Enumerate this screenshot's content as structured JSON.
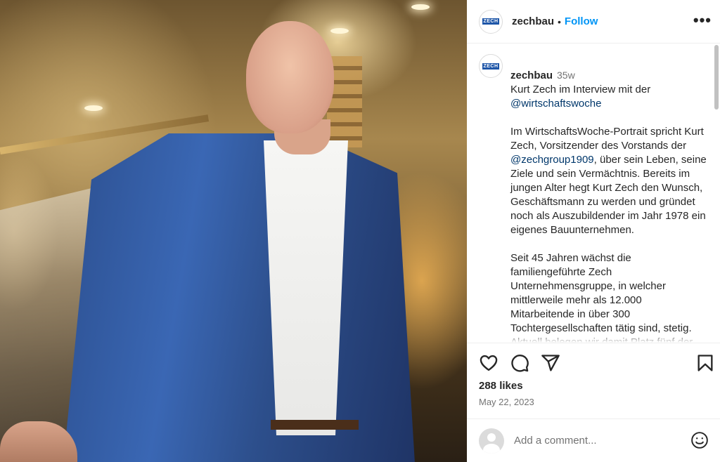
{
  "post": {
    "image_alt": "Kurt Zech in a blue suit standing on a staircase"
  },
  "header": {
    "avatar_logo": "ZECH",
    "username": "zechbau",
    "separator": "•",
    "follow_label": "Follow",
    "more_label": "•••"
  },
  "caption": {
    "username": "zechbau",
    "time": "35w",
    "line1": "Kurt Zech im Interview mit der",
    "mention1": "@wirtschaftswoche",
    "para2_a": "Im WirtschaftsWoche-Portrait spricht Kurt Zech, Vorsitzender des Vorstands der ",
    "mention2": "@zechgroup1909",
    "para2_b": ", über sein Leben, seine Ziele und sein Vermächtnis. Bereits im jungen Alter hegt Kurt Zech den Wunsch, Geschäftsmann zu werden und gründet noch als Auszubildender im Jahr 1978 ein eigenes Bauunternehmen.",
    "para3": "Seit 45 Jahren wächst die familiengeführte Zech Unternehmensgruppe, in welcher mittlerweile mehr als 12.000 Mitarbeitende in über 300 Tochtergesellschaften tätig sind, stetig. Aktuell belegen wir damit Platz fünf der größten Firmen der Baubranche"
  },
  "actions": {
    "like_icon": "heart-icon",
    "comment_icon": "comment-icon",
    "share_icon": "send-icon",
    "save_icon": "bookmark-icon",
    "likes": "288 likes",
    "date": "May 22, 2023"
  },
  "comment": {
    "placeholder": "Add a comment...",
    "emoji_icon": "emoji-icon"
  },
  "colors": {
    "accent": "#0095f6",
    "mention": "#00376b",
    "muted": "#737373",
    "brand_logo": "#1e56a8"
  }
}
